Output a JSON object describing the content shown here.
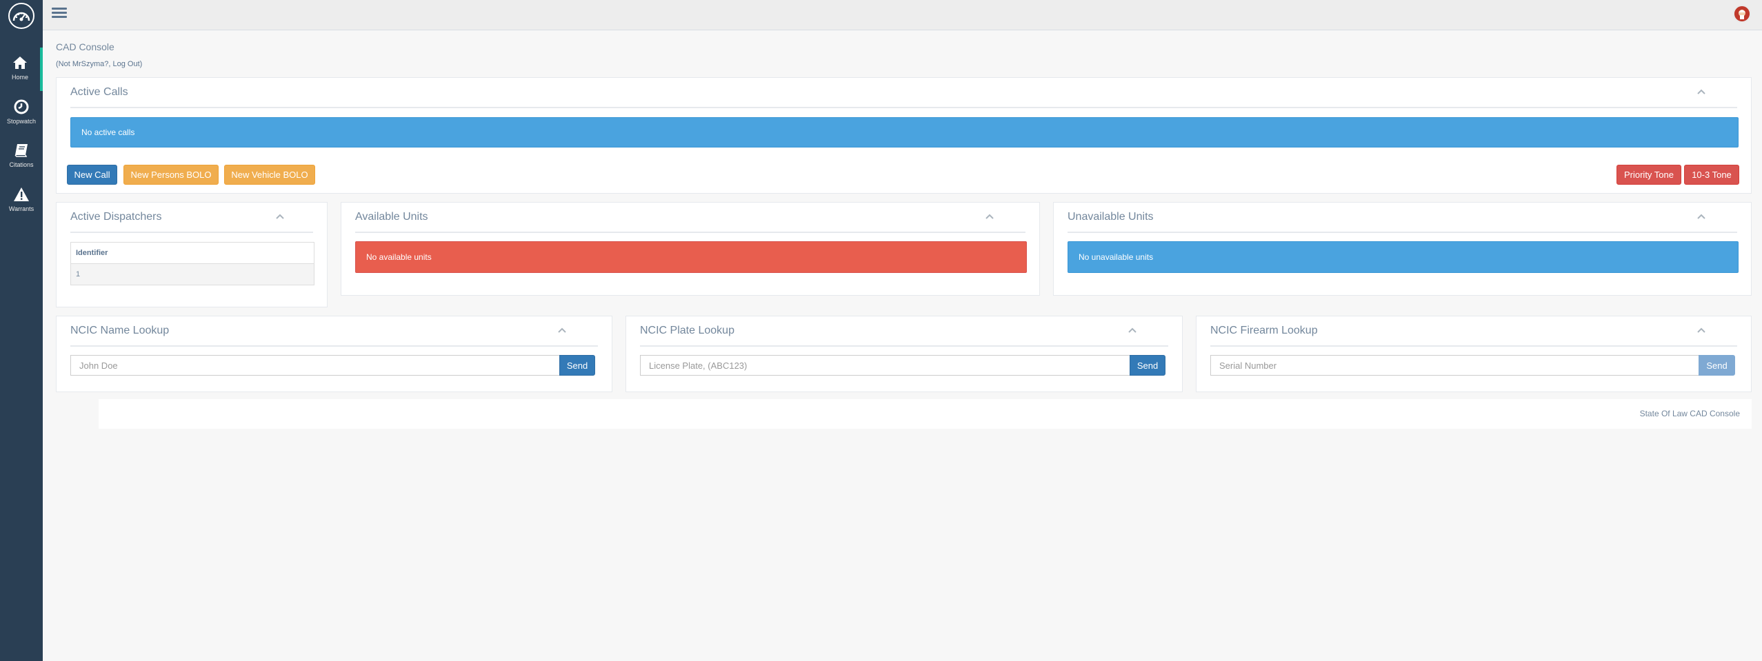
{
  "sidebar": {
    "items": [
      {
        "label": "Home",
        "icon": "home-icon"
      },
      {
        "label": "Stopwatch",
        "icon": "stopwatch-icon"
      },
      {
        "label": "Citations",
        "icon": "book-icon"
      },
      {
        "label": "Warrants",
        "icon": "warning-icon"
      }
    ]
  },
  "header": {
    "title": "CAD Console",
    "logout_prefix": "(Not MrSzyma?, ",
    "logout_label": "Log Out",
    "logout_suffix": ")"
  },
  "active_calls": {
    "title": "Active Calls",
    "message": "No active calls",
    "buttons": {
      "new_call": "New Call",
      "new_persons_bolo": "New Persons BOLO",
      "new_vehicle_bolo": "New Vehicle BOLO",
      "priority_tone": "Priority Tone",
      "ten_three_tone": "10-3 Tone"
    }
  },
  "active_dispatchers": {
    "title": "Active Dispatchers",
    "table": {
      "columns": [
        "Identifier"
      ],
      "rows": [
        [
          "1"
        ]
      ]
    }
  },
  "available_units": {
    "title": "Available Units",
    "message": "No available units"
  },
  "unavailable_units": {
    "title": "Unavailable Units",
    "message": "No unavailable units"
  },
  "ncic": {
    "name": {
      "title": "NCIC Name Lookup",
      "placeholder": "John Doe",
      "send": "Send"
    },
    "plate": {
      "title": "NCIC Plate Lookup",
      "placeholder": "License Plate, (ABC123)",
      "send": "Send"
    },
    "firearm": {
      "title": "NCIC Firearm Lookup",
      "placeholder": "Serial Number",
      "send": "Send"
    }
  },
  "footer": {
    "text": "State Of Law CAD Console"
  },
  "colors": {
    "sidebar": "#2a3f54",
    "accent": "#1abb9c",
    "info": "#4aa3df",
    "danger": "#e85e4e",
    "primary": "#337ab7",
    "warning": "#f0ad4e"
  }
}
